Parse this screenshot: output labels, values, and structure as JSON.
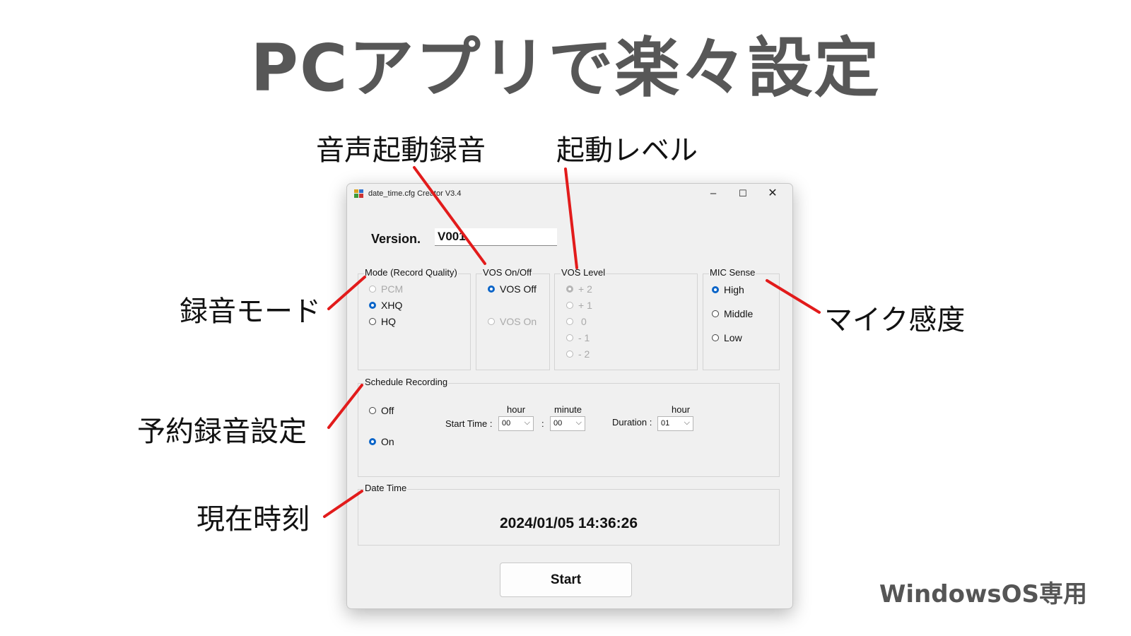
{
  "headline": "PCアプリで楽々設定",
  "callouts": {
    "vos_onoff": "音声起動録音",
    "vos_level": "起動レベル",
    "mode": "録音モード",
    "mic_sense": "マイク感度",
    "schedule": "予約録音設定",
    "datetime": "現在時刻"
  },
  "footnote": "WindowsOS専用",
  "colors": {
    "callout_line": "#e21b1b",
    "radio_checked": "#0a64c8",
    "headline": "#575757"
  },
  "window": {
    "title": "date_time.cfg Creator V3.4",
    "controls": {
      "minimize": "–",
      "maximize": "☐",
      "close": "✕"
    },
    "version": {
      "label": "Version.",
      "value": "V001"
    },
    "mode": {
      "title": "Mode (Record Quality)",
      "options": [
        "PCM",
        "XHQ",
        "HQ"
      ],
      "selected": "XHQ",
      "disabled": [
        "PCM"
      ]
    },
    "vos": {
      "title": "VOS On/Off",
      "options": [
        "VOS Off",
        "VOS On"
      ],
      "selected": "VOS Off",
      "disabled": [
        "VOS On"
      ]
    },
    "vos_level": {
      "title": "VOS Level",
      "options": [
        "+ 2",
        "+ 1",
        "0",
        "- 1",
        "- 2"
      ],
      "selected": "+ 2",
      "all_disabled": true
    },
    "mic": {
      "title": "MIC Sense",
      "options": [
        "High",
        "Middle",
        "Low"
      ],
      "selected": "High"
    },
    "schedule": {
      "title": "Schedule Recording",
      "off_label": "Off",
      "on_label": "On",
      "selected": "On",
      "start_time_label": "Start Time :",
      "hour_label": "hour",
      "minute_label": "minute",
      "hour_value": "00",
      "minute_value": "00",
      "colon": ":",
      "duration_label": "Duration :",
      "duration_hour_label": "hour",
      "duration_value": "01"
    },
    "datetime": {
      "title": "Date  Time",
      "value": "2024/01/05 14:36:26"
    },
    "start_button": "Start"
  }
}
